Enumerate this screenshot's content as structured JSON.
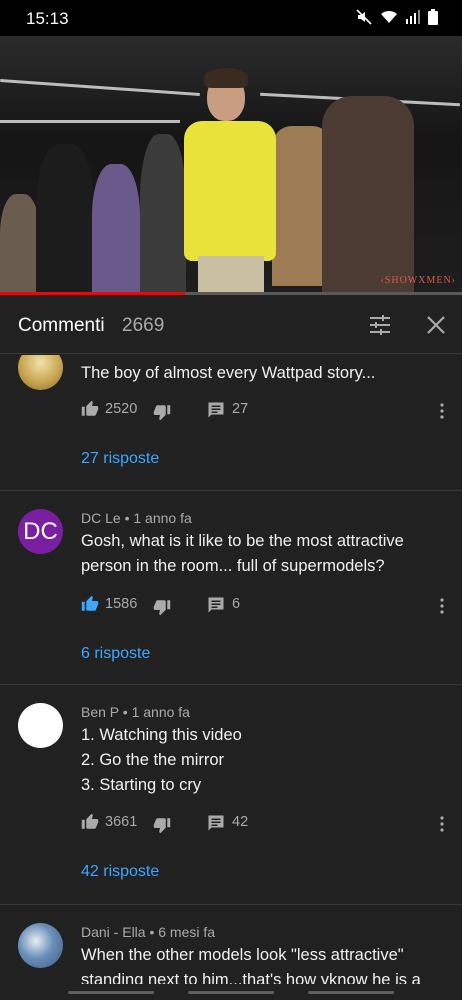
{
  "status_bar": {
    "time": "15:13",
    "icons": [
      "mute-icon",
      "wifi-icon",
      "signal-icon",
      "battery-icon"
    ]
  },
  "video": {
    "watermark": "‹SHOWXMEN›",
    "progress": 0.4
  },
  "comments_header": {
    "title": "Commenti",
    "count": "2669",
    "icons": [
      "filter-icon",
      "close-icon"
    ]
  },
  "comments": [
    {
      "author": "",
      "time": "",
      "text": "The boy of almost every Wattpad story...",
      "likes": "2520",
      "liked": false,
      "replies": "27",
      "replies_link": "27 risposte",
      "avatar": "gold"
    },
    {
      "author": "DC Le",
      "time": "1 anno fa",
      "meta": "DC Le • 1 anno fa",
      "avatar_text": "DC",
      "text": "Gosh, what is it like to be the most attractive person in the room... full of supermodels?",
      "likes": "1586",
      "liked": true,
      "replies": "6",
      "replies_link": "6 risposte",
      "avatar": "purple"
    },
    {
      "author": "Ben P",
      "time": "1 anno fa",
      "meta": "Ben P • 1 anno fa",
      "text_lines": [
        "1. Watching this video",
        "2. Go the the mirror",
        "3. Starting to cry"
      ],
      "likes": "3661",
      "liked": false,
      "replies": "42",
      "replies_link": "42 risposte",
      "avatar": "white"
    },
    {
      "author": "Dani - Ella",
      "time": "6 mesi fa",
      "meta": "Dani - Ella • 6 mesi fa",
      "text": "When the other models look \"less attractive\" standing next to him...that's how yknow he is a",
      "avatar": "blue"
    }
  ],
  "colors": {
    "background": "#212121",
    "link": "#3ea6ff",
    "accent": "#ff0000",
    "liked": "#3ea6ff"
  }
}
